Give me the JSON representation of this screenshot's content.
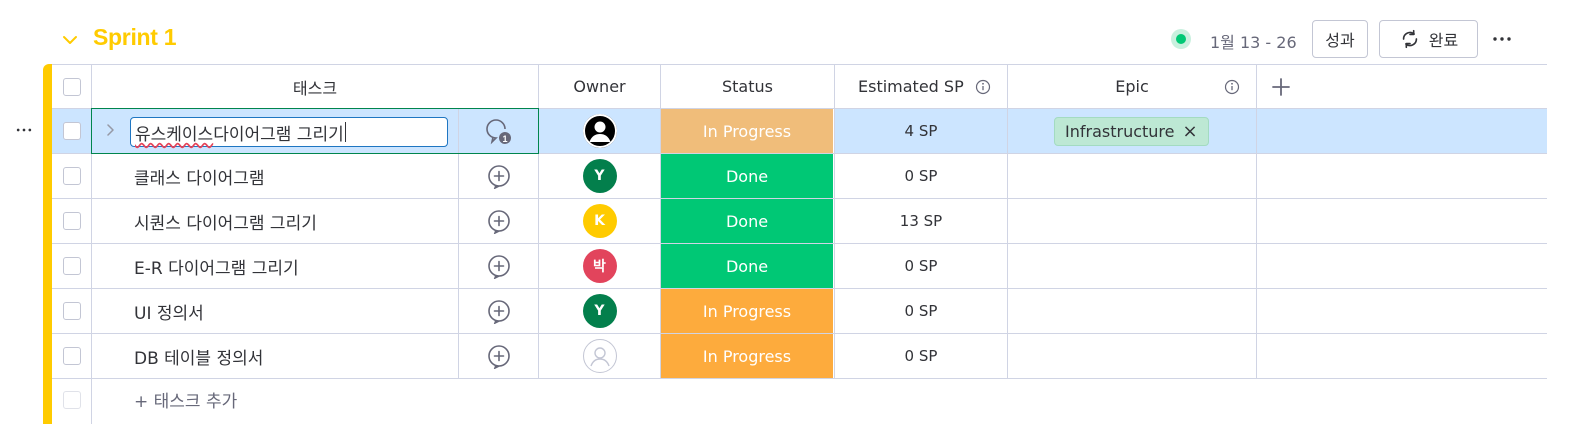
{
  "group": {
    "title": "Sprint 1",
    "dates": "1월 13 - 26",
    "result_label": "성과",
    "complete_label": "완료",
    "accent": "#ffcb00"
  },
  "columns": {
    "task": "태스크",
    "owner": "Owner",
    "status": "Status",
    "estimated_sp": "Estimated SP",
    "epic": "Epic"
  },
  "rows": [
    {
      "task": "유스케이스 다이어그램 그리기",
      "owner_initial": "",
      "owner_color": "#000000",
      "status": "In Progress",
      "status_color": "#f0bd7a",
      "sp": "4 SP",
      "epic": "Infrastructure",
      "conversations": "1"
    },
    {
      "task": "클래스 다이어그램",
      "owner_initial": "Y",
      "owner_color": "#037f4c",
      "status": "Done",
      "status_color": "#00c875",
      "sp": "0 SP",
      "epic": ""
    },
    {
      "task": "시퀀스 다이어그램 그리기",
      "owner_initial": "K",
      "owner_color": "#ffcb00",
      "status": "Done",
      "status_color": "#00c875",
      "sp": "13 SP",
      "epic": ""
    },
    {
      "task": "E-R 다이어그램 그리기",
      "owner_initial": "박",
      "owner_color": "#e2445c",
      "status": "Done",
      "status_color": "#00c875",
      "sp": "0 SP",
      "epic": ""
    },
    {
      "task": "UI 정의서",
      "owner_initial": "Y",
      "owner_color": "#037f4c",
      "status": "In Progress",
      "status_color": "#fdab3d",
      "sp": "0 SP",
      "epic": ""
    },
    {
      "task": "DB 테이블 정의서",
      "owner_initial": "",
      "owner_color": "",
      "status": "In Progress",
      "status_color": "#fdab3d",
      "sp": "0 SP",
      "epic": ""
    }
  ],
  "edit": {
    "misspelled": "유스케이스",
    "rest": " 다이어그램 그리기"
  },
  "add_task_label": "+ 태스크 추가"
}
